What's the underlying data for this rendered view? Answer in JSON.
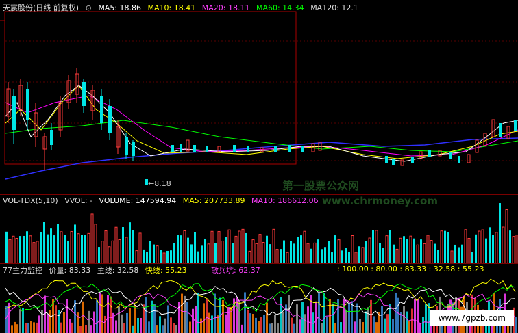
{
  "main": {
    "title": "天宸股份(日线 前复权)",
    "ma5": "MA5: 18.86",
    "ma10": "MA10: 18.41",
    "ma20": "MA20: 18.11",
    "ma60": "MA60: 14.34",
    "ma120": "MA120: 12.1",
    "low_mark": "←8.18"
  },
  "volume": {
    "name": "VOL-TDX(5,10)",
    "vvol": "VVOL: -",
    "vol": "VOLUME: 147594.94",
    "ma5": "MA5: 207733.89",
    "ma10": "MA10: 186612.06"
  },
  "indicator": {
    "name": "77主力监控",
    "price": "价量: 83.33",
    "main": "主线: 32.58",
    "fast": "快线: 55.23",
    "retail": "散兵坑: 62.37",
    "readout": ": 100.00 : 80.00 : 83.33 : 32.58 : 55.23"
  },
  "watermarks": {
    "cn": "第一股票公众网",
    "url": "www.chrmoney.com",
    "site": "www.7gpzb.com"
  },
  "colors": {
    "up": "#ff3a3a",
    "down": "#00e6e6",
    "ma5": "#ffffff",
    "ma10": "#ffff00",
    "ma20": "#ff00ff",
    "ma60": "#00ff00",
    "ma120": "#3030ff"
  }
}
